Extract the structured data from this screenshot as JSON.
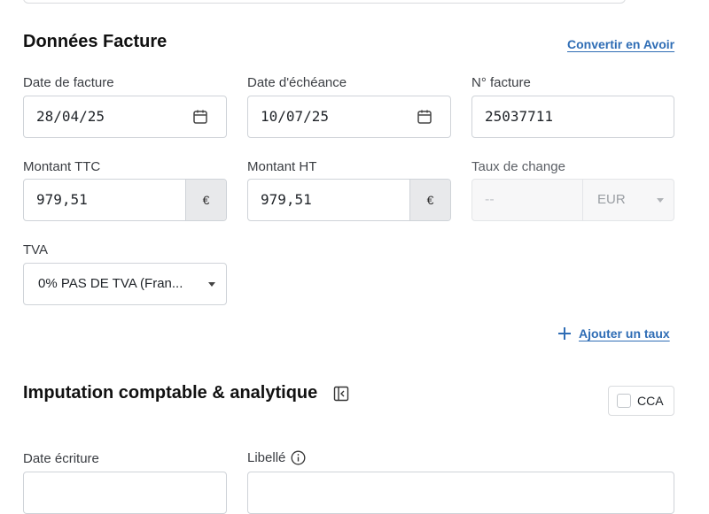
{
  "invoice_section": {
    "title": "Données Facture",
    "convert_link": "Convertir en Avoir",
    "invoice_date": {
      "label": "Date de facture",
      "value": "28/04/25"
    },
    "due_date": {
      "label": "Date d'échéance",
      "value": "10/07/25"
    },
    "invoice_number": {
      "label": "N° facture",
      "value": "25037711"
    },
    "amount_ttc": {
      "label": "Montant TTC",
      "value": "979,51",
      "currency": "€"
    },
    "amount_ht": {
      "label": "Montant HT",
      "value": "979,51",
      "currency": "€"
    },
    "exchange_rate": {
      "label": "Taux de change",
      "placeholder": "--",
      "currency": "EUR"
    },
    "vat": {
      "label": "TVA",
      "selected": "0% PAS DE TVA (Fran..."
    },
    "add_rate_link": "Ajouter un taux"
  },
  "accounting_section": {
    "title": "Imputation comptable & analytique",
    "cca_label": "CCA",
    "entry_date_label": "Date écriture",
    "description_label": "Libellé"
  },
  "icons": {
    "calendar": "calendar-icon",
    "collapse": "collapse-panel-icon",
    "plus": "plus-icon",
    "info": "info-icon",
    "caret": "caret-down-icon"
  },
  "colors": {
    "link": "#2f6db5",
    "border": "#cfd3d8",
    "suffix_bg": "#e8e9eb"
  }
}
